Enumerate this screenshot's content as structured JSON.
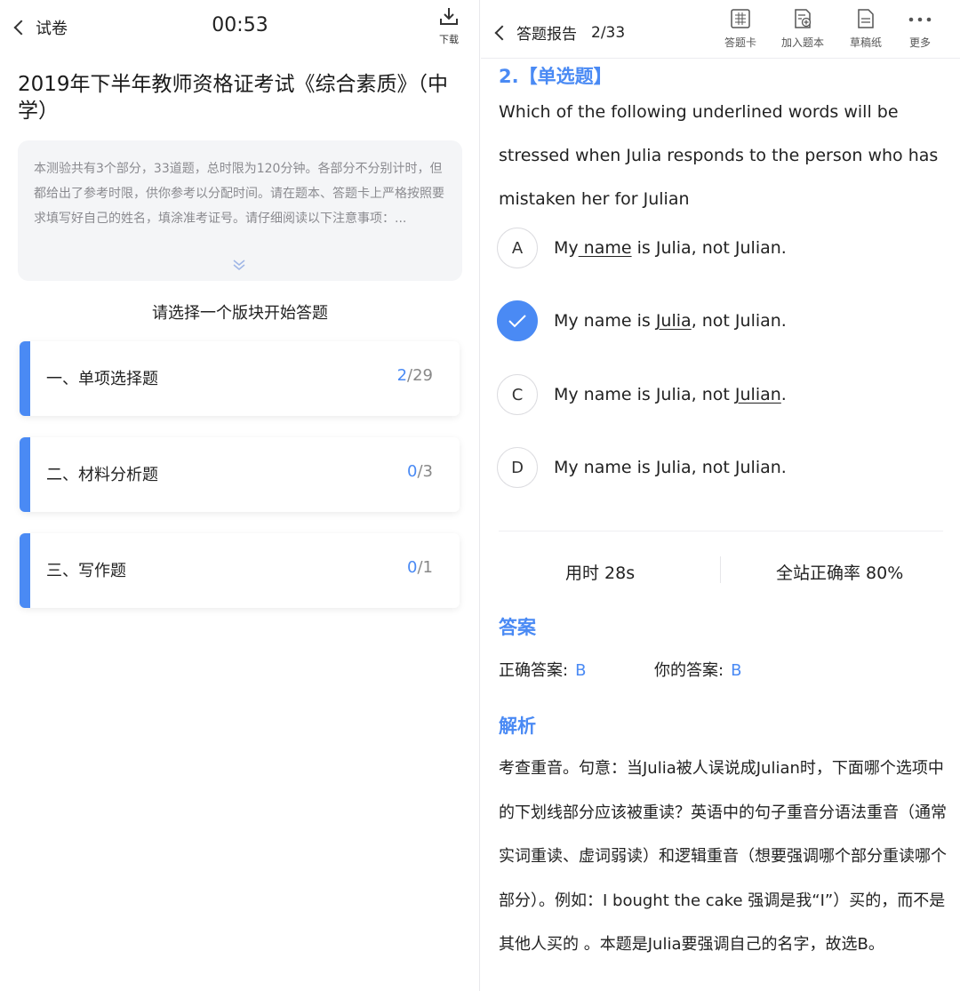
{
  "left": {
    "back_label": "试卷",
    "timer": "00:53",
    "download_label": "下载",
    "exam_title": "2019年下半年教师资格证考试《综合素质》（中学）",
    "description": "本测验共有3个部分，33道题，总时限为120分钟。各部分不分别计时，但都给出了参考时限，供你参考以分配时间。请在题本、答题卡上严格按照要求填写好自己的姓名，填涂准考证号。请仔细阅读以下注意事项：...",
    "pick_prompt": "请选择一个版块开始答题",
    "sections": [
      {
        "name": "一、单项选择题",
        "done": "2",
        "total": "/29"
      },
      {
        "name": "二、材料分析题",
        "done": "0",
        "total": "/3"
      },
      {
        "name": "三、写作题",
        "done": "0",
        "total": "/1"
      }
    ]
  },
  "right": {
    "back_label": "答题报告",
    "count": "2/33",
    "tools": [
      {
        "label": "答题卡",
        "icon": "answer-card-icon"
      },
      {
        "label": "加入题本",
        "icon": "add-note-icon"
      },
      {
        "label": "草稿纸",
        "icon": "draft-paper-icon"
      },
      {
        "label": "更多",
        "icon": "more-icon"
      }
    ],
    "question_type": "2.【单选题】",
    "question_stem": "Which of the following underlined words will be stressed when Julia responds to the person who has mistaken her for Julian",
    "options": [
      {
        "letter": "A",
        "pre": "My",
        "under": " name",
        "post": " is Julia, not Julian.",
        "selected": false
      },
      {
        "letter": "B",
        "pre": "My name is ",
        "under": "Julia",
        "post": ", not Julian.",
        "selected": true
      },
      {
        "letter": "C",
        "pre": "My name is Julia, not ",
        "under": "Julian",
        "post": ".",
        "selected": false
      },
      {
        "letter": "D",
        "pre": "My name is Julia, not Julian.",
        "under": "",
        "post": "",
        "selected": false
      }
    ],
    "time_used": "用时 28s",
    "accuracy": "全站正确率 80%",
    "answer_heading": "答案",
    "correct_label": "正确答案:",
    "correct_value": "B",
    "mine_label": "你的答案:",
    "mine_value": "B",
    "analysis_heading": "解析",
    "analysis_text": "考查重音。句意：当Julia被人误说成Julian时，下面哪个选项中的下划线部分应该被重读？英语中的句子重音分语法重音（通常实词重读、虚词弱读）和逻辑重音（想要强调哪个部分重读哪个部分）。例如：I bought the cake 强调是我“I”）买的，而不是其他人买的 。本题是Julia要强调自己的名字，故选B。",
    "accent_color": "#4a8af4"
  }
}
